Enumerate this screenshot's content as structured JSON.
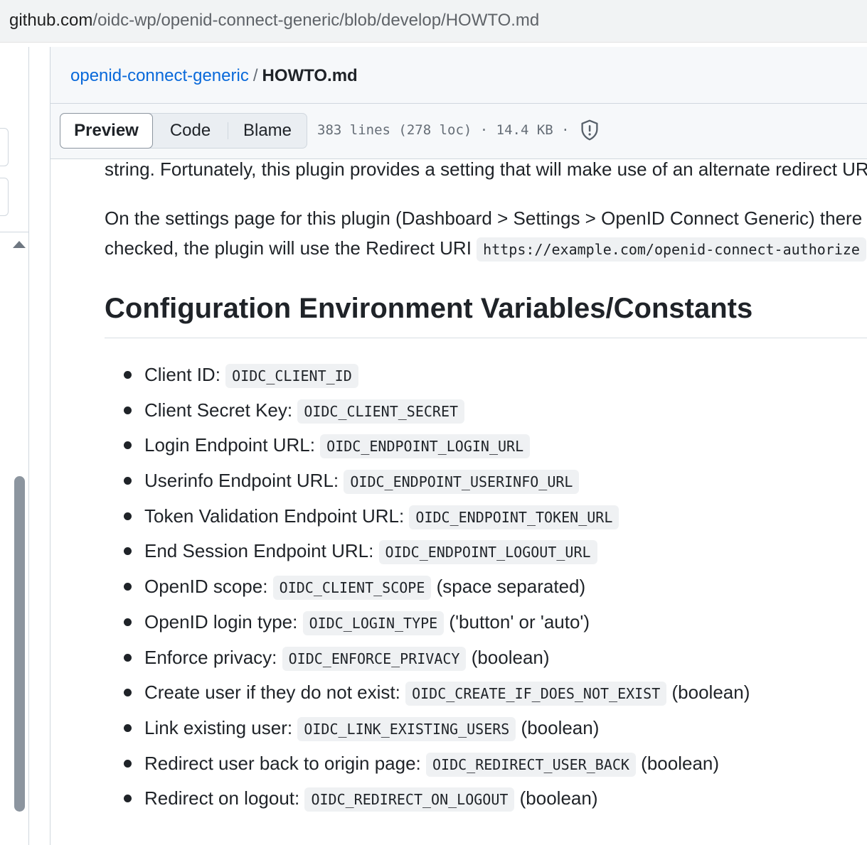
{
  "browser": {
    "url_host": "github.com",
    "url_path": "/oidc-wp/openid-connect-generic/blob/develop/HOWTO.md"
  },
  "file_header": {
    "repo_link": "openid-connect-generic",
    "separator": "/",
    "file_name": "HOWTO.md",
    "tabs": [
      "Preview",
      "Code",
      "Blame"
    ],
    "active_tab": "Preview",
    "info": "383 lines (278 loc) · 14.4 KB ·",
    "icon": "shield-icon"
  },
  "content": {
    "p0": "string. Fortunately, this plugin provides a setting that will make use of an alternate redirect URI that does not include a query",
    "p1": "On the settings page for this plugin (Dashboard > Settings > OpenID Connect Generic) there is a checkbox for Alternate Redirect URI. When",
    "p2_text": "checked, the plugin will use the Redirect URI ",
    "p2_code": "https://example.com/openid-connect-authorize",
    "heading": "Configuration Environment Variables/Constants",
    "items": [
      {
        "label": "Client ID: ",
        "code": "OIDC_CLIENT_ID",
        "suffix": ""
      },
      {
        "label": "Client Secret Key: ",
        "code": "OIDC_CLIENT_SECRET",
        "suffix": ""
      },
      {
        "label": "Login Endpoint URL: ",
        "code": "OIDC_ENDPOINT_LOGIN_URL",
        "suffix": ""
      },
      {
        "label": "Userinfo Endpoint URL: ",
        "code": "OIDC_ENDPOINT_USERINFO_URL",
        "suffix": ""
      },
      {
        "label": "Token Validation Endpoint URL: ",
        "code": "OIDC_ENDPOINT_TOKEN_URL",
        "suffix": ""
      },
      {
        "label": "End Session Endpoint URL: ",
        "code": "OIDC_ENDPOINT_LOGOUT_URL",
        "suffix": ""
      },
      {
        "label": "OpenID scope: ",
        "code": "OIDC_CLIENT_SCOPE",
        "suffix": " (space separated)"
      },
      {
        "label": "OpenID login type: ",
        "code": "OIDC_LOGIN_TYPE",
        "suffix": " ('button' or 'auto')"
      },
      {
        "label": "Enforce privacy: ",
        "code": "OIDC_ENFORCE_PRIVACY",
        "suffix": " (boolean)"
      },
      {
        "label": "Create user if they do not exist: ",
        "code": "OIDC_CREATE_IF_DOES_NOT_EXIST",
        "suffix": " (boolean)"
      },
      {
        "label": "Link existing user: ",
        "code": "OIDC_LINK_EXISTING_USERS",
        "suffix": " (boolean)"
      },
      {
        "label": "Redirect user back to origin page: ",
        "code": "OIDC_REDIRECT_USER_BACK",
        "suffix": " (boolean)"
      },
      {
        "label": "Redirect on logout: ",
        "code": "OIDC_REDIRECT_ON_LOGOUT",
        "suffix": " (boolean)"
      }
    ]
  }
}
